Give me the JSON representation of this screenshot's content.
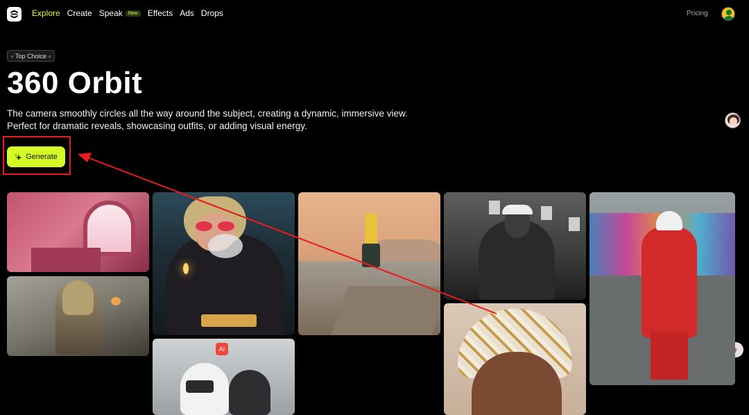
{
  "nav": {
    "items": [
      {
        "label": "Explore",
        "active": true
      },
      {
        "label": "Create",
        "active": false
      },
      {
        "label": "Speak",
        "active": false,
        "badge": "New"
      },
      {
        "label": "Effects",
        "active": false
      },
      {
        "label": "Ads",
        "active": false
      },
      {
        "label": "Drops",
        "active": false
      }
    ],
    "pricing": "Pricing"
  },
  "hero": {
    "tag": "Top Choice",
    "title": "360 Orbit",
    "description": "The camera smoothly circles all the way around the subject, creating a dynamic, immersive view. Perfect for dramatic reveals, showcasing outfits, or adding visual energy.",
    "generate_label": "Generate"
  },
  "gallery": {
    "ai_badge": "AI"
  },
  "colors": {
    "accent": "#d4fb25",
    "active_nav": "#d8ff2e",
    "highlight": "#e81b1b",
    "background": "#000000"
  }
}
